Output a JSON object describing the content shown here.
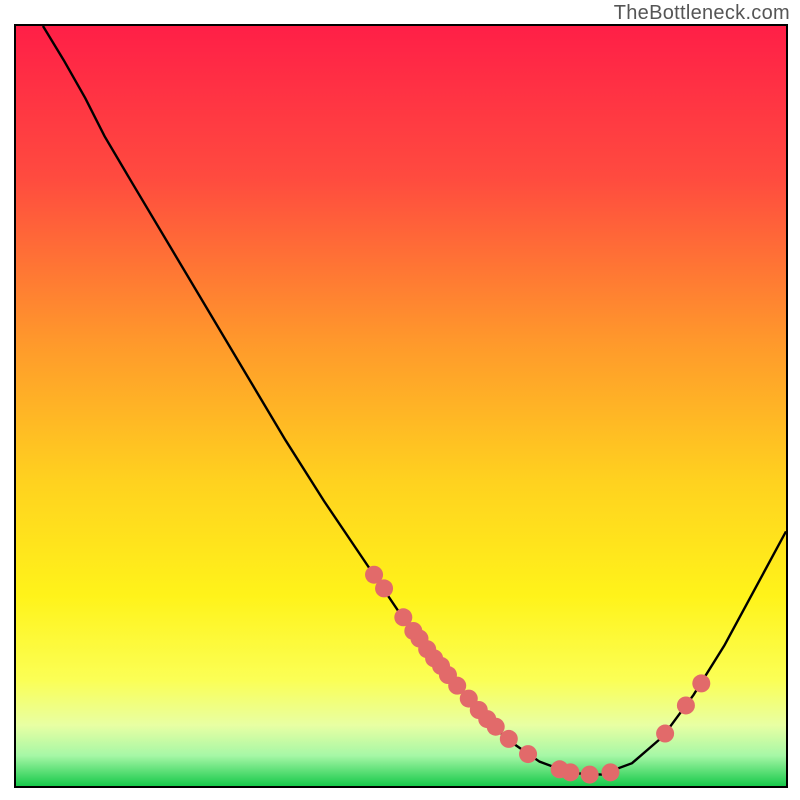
{
  "watermark": "TheBottleneck.com",
  "gradient_stops": [
    {
      "offset": 0,
      "color": "#ff1f47"
    },
    {
      "offset": 20,
      "color": "#ff4b3f"
    },
    {
      "offset": 42,
      "color": "#ff9a2b"
    },
    {
      "offset": 60,
      "color": "#ffd21f"
    },
    {
      "offset": 75,
      "color": "#fff31a"
    },
    {
      "offset": 86,
      "color": "#fbff55"
    },
    {
      "offset": 92,
      "color": "#e8ffa3"
    },
    {
      "offset": 96,
      "color": "#a6f7a6"
    },
    {
      "offset": 100,
      "color": "#17c94a"
    }
  ],
  "curve_points": [
    {
      "x": 0.035,
      "y": 0.0
    },
    {
      "x": 0.062,
      "y": 0.045
    },
    {
      "x": 0.09,
      "y": 0.095
    },
    {
      "x": 0.115,
      "y": 0.145
    },
    {
      "x": 0.15,
      "y": 0.205
    },
    {
      "x": 0.2,
      "y": 0.29
    },
    {
      "x": 0.25,
      "y": 0.375
    },
    {
      "x": 0.3,
      "y": 0.46
    },
    {
      "x": 0.35,
      "y": 0.545
    },
    {
      "x": 0.4,
      "y": 0.625
    },
    {
      "x": 0.45,
      "y": 0.7
    },
    {
      "x": 0.5,
      "y": 0.775
    },
    {
      "x": 0.55,
      "y": 0.84
    },
    {
      "x": 0.6,
      "y": 0.902
    },
    {
      "x": 0.64,
      "y": 0.94
    },
    {
      "x": 0.68,
      "y": 0.968
    },
    {
      "x": 0.72,
      "y": 0.983
    },
    {
      "x": 0.76,
      "y": 0.985
    },
    {
      "x": 0.8,
      "y": 0.97
    },
    {
      "x": 0.84,
      "y": 0.935
    },
    {
      "x": 0.88,
      "y": 0.88
    },
    {
      "x": 0.92,
      "y": 0.815
    },
    {
      "x": 0.96,
      "y": 0.74
    },
    {
      "x": 1.0,
      "y": 0.665
    }
  ],
  "marker_points": [
    {
      "x": 0.465,
      "y": 0.722
    },
    {
      "x": 0.478,
      "y": 0.74
    },
    {
      "x": 0.503,
      "y": 0.778
    },
    {
      "x": 0.516,
      "y": 0.796
    },
    {
      "x": 0.524,
      "y": 0.806
    },
    {
      "x": 0.534,
      "y": 0.82
    },
    {
      "x": 0.543,
      "y": 0.832
    },
    {
      "x": 0.552,
      "y": 0.842
    },
    {
      "x": 0.561,
      "y": 0.854
    },
    {
      "x": 0.573,
      "y": 0.868
    },
    {
      "x": 0.588,
      "y": 0.885
    },
    {
      "x": 0.601,
      "y": 0.9
    },
    {
      "x": 0.612,
      "y": 0.912
    },
    {
      "x": 0.623,
      "y": 0.922
    },
    {
      "x": 0.64,
      "y": 0.938
    },
    {
      "x": 0.665,
      "y": 0.958
    },
    {
      "x": 0.706,
      "y": 0.978
    },
    {
      "x": 0.72,
      "y": 0.982
    },
    {
      "x": 0.745,
      "y": 0.985
    },
    {
      "x": 0.772,
      "y": 0.982
    },
    {
      "x": 0.843,
      "y": 0.931
    },
    {
      "x": 0.87,
      "y": 0.894
    },
    {
      "x": 0.89,
      "y": 0.865
    }
  ],
  "marker_style": {
    "fill": "#e26a6a",
    "r": 9
  },
  "curve_style": {
    "stroke": "#000000",
    "width": 2.4
  },
  "chart_data": {
    "type": "line",
    "title": "",
    "xlabel": "",
    "ylabel": "",
    "xlim": [
      0,
      1
    ],
    "ylim": [
      0,
      1
    ],
    "note": "Axes are unlabeled in the source image; values are normalized 0–1 where x increases rightward and y increases downward (screen coords). The curve appears to depict a bottleneck/optimality curve with a minimum around x≈0.74; red markers highlight a cluster of sampled points along the descending and bottom region of the curve.",
    "series": [
      {
        "name": "curve",
        "x": [
          0.035,
          0.062,
          0.09,
          0.115,
          0.15,
          0.2,
          0.25,
          0.3,
          0.35,
          0.4,
          0.45,
          0.5,
          0.55,
          0.6,
          0.64,
          0.68,
          0.72,
          0.76,
          0.8,
          0.84,
          0.88,
          0.92,
          0.96,
          1.0
        ],
        "y_screen": [
          0.0,
          0.045,
          0.095,
          0.145,
          0.205,
          0.29,
          0.375,
          0.46,
          0.545,
          0.625,
          0.7,
          0.775,
          0.84,
          0.902,
          0.94,
          0.968,
          0.983,
          0.985,
          0.97,
          0.935,
          0.88,
          0.815,
          0.74,
          0.665
        ]
      },
      {
        "name": "markers",
        "x": [
          0.465,
          0.478,
          0.503,
          0.516,
          0.524,
          0.534,
          0.543,
          0.552,
          0.561,
          0.573,
          0.588,
          0.601,
          0.612,
          0.623,
          0.64,
          0.665,
          0.706,
          0.72,
          0.745,
          0.772,
          0.843,
          0.87,
          0.89
        ],
        "y_screen": [
          0.722,
          0.74,
          0.778,
          0.796,
          0.806,
          0.82,
          0.832,
          0.842,
          0.854,
          0.868,
          0.885,
          0.9,
          0.912,
          0.922,
          0.938,
          0.958,
          0.978,
          0.982,
          0.985,
          0.982,
          0.931,
          0.894,
          0.865
        ]
      }
    ]
  }
}
